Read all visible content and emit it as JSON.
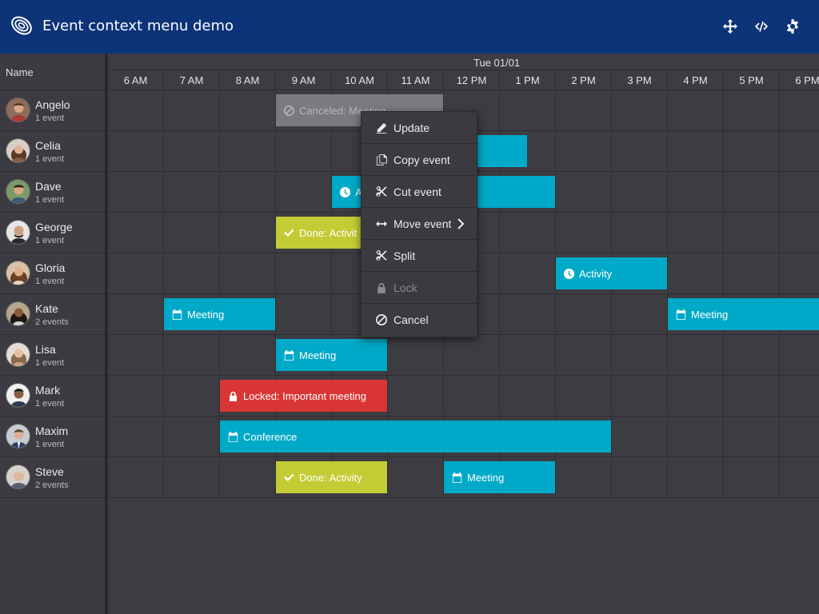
{
  "header": {
    "title": "Event context menu demo",
    "bg_color": "#0d3378",
    "actions": [
      {
        "icon": "move-arrows-icon"
      },
      {
        "icon": "code-icon"
      },
      {
        "icon": "gear-icon"
      }
    ]
  },
  "resource_column": {
    "header": "Name"
  },
  "timeline": {
    "date": "Tue 01/01",
    "hours": [
      "6 AM",
      "7 AM",
      "8 AM",
      "9 AM",
      "10 AM",
      "11 AM",
      "12 PM",
      "1 PM",
      "2 PM",
      "3 PM",
      "4 PM",
      "5 PM",
      "6 PM"
    ]
  },
  "resources": [
    {
      "name": "Angelo",
      "count": "1 event"
    },
    {
      "name": "Celia",
      "count": "1 event"
    },
    {
      "name": "Dave",
      "count": "1 event"
    },
    {
      "name": "George",
      "count": "1 event"
    },
    {
      "name": "Gloria",
      "count": "1 event"
    },
    {
      "name": "Kate",
      "count": "2 events"
    },
    {
      "name": "Lisa",
      "count": "1 event"
    },
    {
      "name": "Mark",
      "count": "1 event"
    },
    {
      "name": "Maxim",
      "count": "1 event"
    },
    {
      "name": "Steve",
      "count": "2 events"
    }
  ],
  "events": [
    {
      "resource": "Angelo",
      "label": "Canceled: Meeting",
      "icon": "ban-icon",
      "style": "canceled",
      "start": "9 AM",
      "end": "12 PM"
    },
    {
      "resource": "Celia",
      "label": "",
      "icon": "",
      "style": "default",
      "start": "11 AM",
      "end": "1 PM"
    },
    {
      "resource": "Dave",
      "label": "A",
      "icon": "clock-icon",
      "style": "default",
      "start": "10 AM",
      "end": "2 PM"
    },
    {
      "resource": "George",
      "label": "Done: Activit",
      "icon": "check-icon",
      "style": "done",
      "start": "9 AM",
      "end": "11 AM"
    },
    {
      "resource": "Gloria",
      "label": "Activity",
      "icon": "clock-icon",
      "style": "default",
      "start": "2 PM",
      "end": "4 PM"
    },
    {
      "resource": "Kate",
      "label": "Meeting",
      "icon": "calendar-icon",
      "style": "default",
      "start": "7 AM",
      "end": "9 AM"
    },
    {
      "resource": "Kate",
      "label": "Meeting",
      "icon": "calendar-icon",
      "style": "default",
      "start": "4 PM",
      "end": "7 PM"
    },
    {
      "resource": "Lisa",
      "label": "Meeting",
      "icon": "calendar-icon",
      "style": "default",
      "start": "9 AM",
      "end": "11 AM"
    },
    {
      "resource": "Mark",
      "label": "Locked: Important meeting",
      "icon": "lock-icon",
      "style": "locked",
      "start": "8 AM",
      "end": "11 AM"
    },
    {
      "resource": "Maxim",
      "label": "Conference",
      "icon": "calendar-icon",
      "style": "default",
      "start": "8 AM",
      "end": "3 PM"
    },
    {
      "resource": "Steve",
      "label": "Done: Activity",
      "icon": "check-icon",
      "style": "done",
      "start": "9 AM",
      "end": "11 AM"
    },
    {
      "resource": "Steve",
      "label": "Meeting",
      "icon": "calendar-icon",
      "style": "default",
      "start": "12 PM",
      "end": "2 PM"
    }
  ],
  "colors": {
    "event_default": "#00a9c7",
    "event_done": "#c3cc34",
    "event_locked": "#d93535",
    "event_canceled": "#7b7b7f"
  },
  "context_menu": {
    "items": [
      {
        "label": "Update",
        "icon": "pencil-icon",
        "enabled": true
      },
      {
        "label": "Copy event",
        "icon": "copy-icon",
        "enabled": true
      },
      {
        "label": "Cut event",
        "icon": "scissors-icon",
        "enabled": true
      },
      {
        "label": "Move event",
        "icon": "horizontal-arrows-icon",
        "enabled": true,
        "submenu": true
      },
      {
        "label": "Split",
        "icon": "scissors-icon",
        "enabled": true
      },
      {
        "label": "Lock",
        "icon": "lock-icon",
        "enabled": false
      },
      {
        "label": "Cancel",
        "icon": "ban-icon",
        "enabled": true
      }
    ]
  }
}
